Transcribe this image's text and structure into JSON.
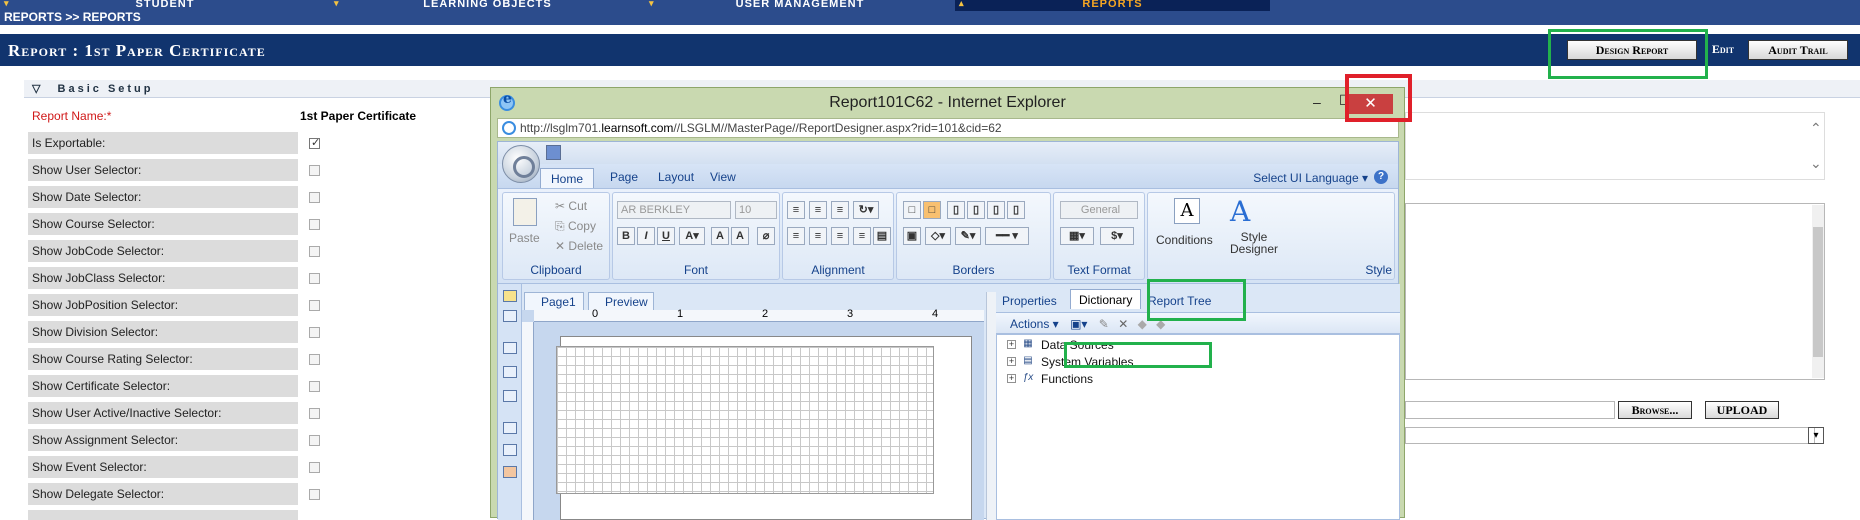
{
  "topnav": {
    "tabs": [
      {
        "label": "Student",
        "active": false
      },
      {
        "label": "Learning Objects",
        "active": false
      },
      {
        "label": "User Management",
        "active": false
      },
      {
        "label": "Reports",
        "active": true
      }
    ]
  },
  "breadcrumb": "Reports >> Reports",
  "page": {
    "title": "Report : 1st Paper Certificate",
    "buttons": {
      "design": "Design Report",
      "edit": "Edit",
      "audit": "Audit Trail"
    }
  },
  "section": {
    "title": "Basic Setup",
    "arrow": "▽"
  },
  "form": {
    "rows": [
      {
        "label": "Report Name:*",
        "value": "1st Paper Certificate",
        "type": "text",
        "required": true
      },
      {
        "label": "Is Exportable:",
        "checked": true,
        "type": "checkbox"
      },
      {
        "label": "Show User Selector:",
        "checked": false,
        "type": "checkbox"
      },
      {
        "label": "Show Date Selector:",
        "checked": false,
        "type": "checkbox"
      },
      {
        "label": "Show Course Selector:",
        "checked": false,
        "type": "checkbox"
      },
      {
        "label": "Show JobCode Selector:",
        "checked": false,
        "type": "checkbox"
      },
      {
        "label": "Show JobClass Selector:",
        "checked": false,
        "type": "checkbox"
      },
      {
        "label": "Show JobPosition Selector:",
        "checked": false,
        "type": "checkbox"
      },
      {
        "label": "Show Division Selector:",
        "checked": false,
        "type": "checkbox"
      },
      {
        "label": "Show Course Rating Selector:",
        "checked": false,
        "type": "checkbox"
      },
      {
        "label": "Show Certificate Selector:",
        "checked": false,
        "type": "checkbox"
      },
      {
        "label": "Show User Active/Inactive Selector:",
        "checked": false,
        "type": "checkbox"
      },
      {
        "label": "Show Assignment Selector:",
        "checked": false,
        "type": "checkbox"
      },
      {
        "label": "Show Event Selector:",
        "checked": false,
        "type": "checkbox"
      },
      {
        "label": "Show Delegate Selector:",
        "checked": false,
        "type": "checkbox"
      }
    ]
  },
  "upload": {
    "browse": "Browse...",
    "upload": "UPLOAD"
  },
  "ie": {
    "title": "Report101C62 - Internet Explorer",
    "minimize": "–",
    "maximize": "☐",
    "close": "✕",
    "url_prefix": "http://lsglm701.",
    "url_domain": "learnsoft.com",
    "url_rest": "//LSGLM//MasterPage//ReportDesigner.aspx?rid=101&cid=62"
  },
  "ribbon": {
    "tabs": [
      "Home",
      "Page",
      "Layout",
      "View"
    ],
    "active_tab": "Home",
    "select_ui": "Select UI Language ▾",
    "help": "?",
    "clipboard": {
      "paste": "Paste",
      "cut": "Cut",
      "copy": "Copy",
      "delete": "Delete",
      "label": "Clipboard"
    },
    "font": {
      "name": "AR BERKLEY",
      "size": "10",
      "label": "Font"
    },
    "alignment": {
      "label": "Alignment"
    },
    "borders": {
      "label": "Borders"
    },
    "textformat": {
      "format": "General",
      "label": "Text Format"
    },
    "style": {
      "conditions": "Conditions",
      "style_designer_1": "Style",
      "style_designer_2": "Designer",
      "label": "Style"
    }
  },
  "pages": {
    "page1": "Page1",
    "preview": "Preview"
  },
  "ruler": [
    "0",
    "1",
    "2",
    "3",
    "4"
  ],
  "panel": {
    "tabs": {
      "properties": "Properties",
      "dictionary": "Dictionary",
      "report_tree": "Report Tree"
    },
    "actions": "Actions ▾",
    "tree": [
      {
        "label": "Data Sources",
        "icon": "table-icon"
      },
      {
        "label": "System Variables",
        "icon": "variables-icon"
      },
      {
        "label": "Functions",
        "icon": "function-icon"
      }
    ]
  },
  "colors": {
    "nav": "#2c4c8c",
    "title": "#11346e",
    "accent": "#f5a623",
    "highlight_green": "#22b14c",
    "highlight_red": "#e0202a"
  }
}
